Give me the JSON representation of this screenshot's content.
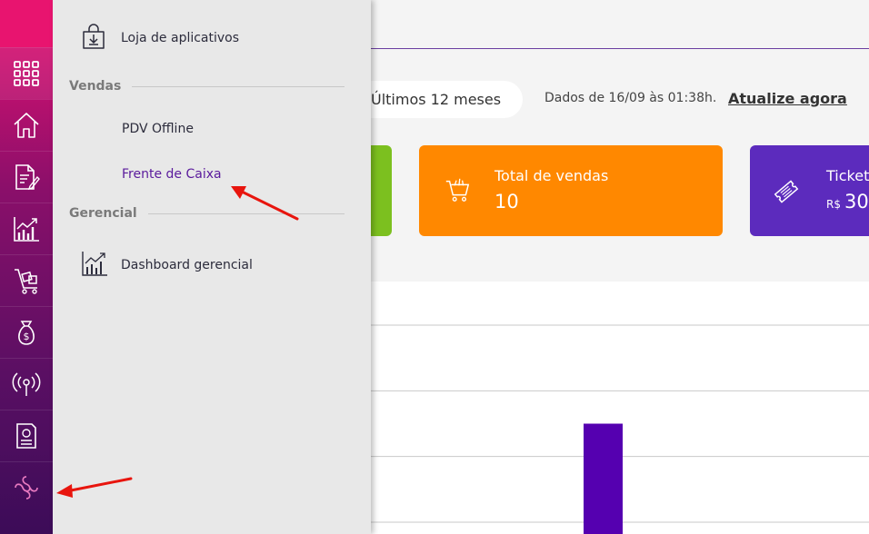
{
  "rail": {
    "items": [
      {
        "icon": "apps-grid-icon"
      },
      {
        "icon": "home-icon"
      },
      {
        "icon": "document-edit-icon"
      },
      {
        "icon": "chart-icon"
      },
      {
        "icon": "cart-icon"
      },
      {
        "icon": "money-bag-icon"
      },
      {
        "icon": "broadcast-icon"
      },
      {
        "icon": "receipt-icon"
      },
      {
        "icon": "plugin-icon"
      }
    ]
  },
  "flyout": {
    "app_store_label": "Loja de aplicativos",
    "sections": [
      {
        "title": "Vendas",
        "items": [
          "PDV Offline",
          "Frente de Caixa"
        ]
      },
      {
        "title": "Gerencial",
        "items": [
          "Dashboard gerencial"
        ]
      }
    ]
  },
  "toolbar": {
    "period": "Últimos 12 meses",
    "data_timestamp": "Dados de 16/09 às 01:38h.",
    "refresh_link": "Atualize agora"
  },
  "cards": [
    {
      "title": "Total de vendas",
      "value": "10",
      "color": "#ff8800"
    },
    {
      "title": "Ticket",
      "currency": "R$",
      "value": "30",
      "color": "#5c2bbd"
    }
  ],
  "colors": {
    "accent": "#5a1a9c",
    "bar": "#5500b0",
    "annotation_arrow": "#e8150e"
  },
  "chart_data": {
    "type": "bar",
    "values": [
      2,
      9
    ],
    "ylim": [
      0,
      12
    ],
    "grid": true
  }
}
